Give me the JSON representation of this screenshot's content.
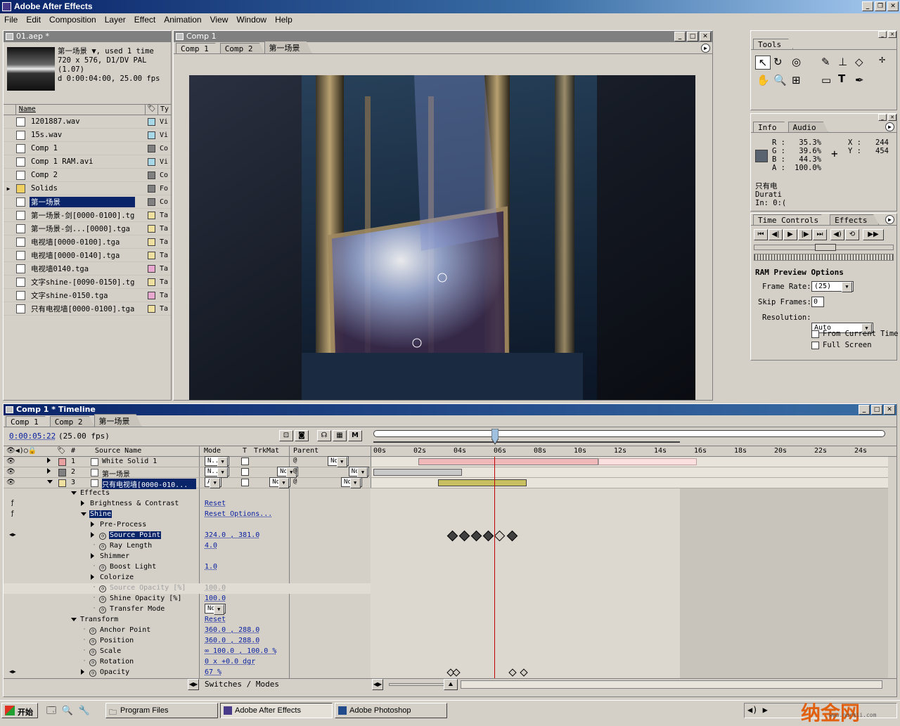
{
  "app": {
    "title": "Adobe After Effects"
  },
  "menu": [
    "File",
    "Edit",
    "Composition",
    "Layer",
    "Effect",
    "Animation",
    "View",
    "Window",
    "Help"
  ],
  "project": {
    "title": "01.aep *",
    "info_line1": "第一场景 ▼, used 1 time",
    "info_line2": "720 x 576, D1/DV PAL (1.07)",
    "info_line3": "d 0:00:04:00, 25.00 fps",
    "col_name": "Name",
    "col_type": "Ty",
    "items": [
      {
        "name": "1201887.wav",
        "type": "Vi",
        "color": "#a8d8e8"
      },
      {
        "name": "15s.wav",
        "type": "Vi",
        "color": "#a8d8e8"
      },
      {
        "name": "Comp 1",
        "type": "Co",
        "color": "#808080"
      },
      {
        "name": "Comp 1 RAM.avi",
        "type": "Vi",
        "color": "#a8d8e8"
      },
      {
        "name": "Comp 2",
        "type": "Co",
        "color": "#808080"
      },
      {
        "name": "Solids",
        "type": "Fo",
        "color": "#808080"
      },
      {
        "name": "第一场景",
        "type": "Co",
        "color": "#808080"
      },
      {
        "name": "第一场景-剑[0000-0100].tga",
        "type": "Ta",
        "color": "#f0e0a0"
      },
      {
        "name": "第一场景-剑...[0000].tga",
        "type": "Ta",
        "color": "#f0e0a0"
      },
      {
        "name": "电视墙[0000-0100].tga",
        "type": "Ta",
        "color": "#f0e0a0"
      },
      {
        "name": "电视墙[0000-0140].tga",
        "type": "Ta",
        "color": "#f0e0a0"
      },
      {
        "name": "电视墙0140.tga",
        "type": "Ta",
        "color": "#e8a8d0"
      },
      {
        "name": "文字shine-[0090-0150].tga",
        "type": "Ta",
        "color": "#f0e0a0"
      },
      {
        "name": "文字shine-0150.tga",
        "type": "Ta",
        "color": "#e8a8d0"
      },
      {
        "name": "只有电视墙[0000-0100].tga",
        "type": "Ta",
        "color": "#f0e0a0"
      }
    ]
  },
  "comp_window": {
    "title": "Comp 1",
    "tabs": [
      "Comp 1",
      "Comp 2",
      "第一场景"
    ]
  },
  "tools": {
    "title": "Tools"
  },
  "info": {
    "tabs": [
      "Info",
      "Audio"
    ],
    "R": "35.3%",
    "G": "39.6%",
    "B": "44.3%",
    "A": "100.0%",
    "X": "244",
    "Y": "454",
    "line1": "只有电",
    "line2": "Durati",
    "line3": "In: 0:("
  },
  "time_controls": {
    "tabs": [
      "Time Controls",
      "Effects"
    ],
    "ram_title": "RAM Preview Options",
    "frame_rate_label": "Frame Rate:",
    "frame_rate": "(25)",
    "skip_label": "Skip Frames:",
    "skip": "0",
    "res_label": "Resolution:",
    "res": "Auto",
    "from_current": "From Current Time",
    "full_screen": "Full Screen"
  },
  "timeline": {
    "title": "Comp 1 * Timeline",
    "tabs": [
      "Comp 1",
      "Comp 2",
      "第一场景"
    ],
    "time": "0:00:05:22",
    "fps": "(25.00 fps)",
    "headers": {
      "num": "#",
      "source": "Source Name",
      "mode": "Mode",
      "t": "T",
      "trkmat": "TrkMat",
      "parent": "Parent"
    },
    "ruler": [
      "00s",
      "02s",
      "04s",
      "06s",
      "08s",
      "10s",
      "12s",
      "14s",
      "16s",
      "18s",
      "20s",
      "22s",
      "24s"
    ],
    "layers": [
      {
        "num": "1",
        "name": "White Solid 1",
        "mode": "N...1",
        "trk": "",
        "parent": "None",
        "color": "#e8a0a0"
      },
      {
        "num": "2",
        "name": "第一场景",
        "mode": "N...1",
        "trk": "None",
        "parent": "None",
        "color": "#808080"
      },
      {
        "num": "3",
        "name": "只有电视墙[0000-010...",
        "mode": "Add",
        "trk": "None",
        "parent": "None",
        "color": "#f0e0a0"
      }
    ],
    "props": [
      {
        "label": "Effects",
        "indent": 1,
        "tri": "dn",
        "value": ""
      },
      {
        "label": "Brightness & Contrast",
        "indent": 2,
        "tri": "r",
        "value": "Reset"
      },
      {
        "label": "Shine",
        "indent": 2,
        "tri": "dn",
        "value": "Reset Options...",
        "sel": true
      },
      {
        "label": "Pre-Process",
        "indent": 3,
        "tri": "r",
        "value": ""
      },
      {
        "label": "Source Point",
        "indent": 3,
        "tri": "r",
        "stop": true,
        "value": "324.0 , 381.0",
        "sel": true
      },
      {
        "label": "Ray Length",
        "indent": 3,
        "stop": true,
        "value": "4.0"
      },
      {
        "label": "Shimmer",
        "indent": 3,
        "tri": "r",
        "value": ""
      },
      {
        "label": "Boost Light",
        "indent": 3,
        "stop": true,
        "value": "1.0"
      },
      {
        "label": "Colorize",
        "indent": 3,
        "tri": "r",
        "value": ""
      },
      {
        "label": "Source Opacity [%]",
        "indent": 3,
        "stop": true,
        "value": "100.0",
        "dim": true
      },
      {
        "label": "Shine Opacity [%]",
        "indent": 3,
        "stop": true,
        "value": "100.0"
      },
      {
        "label": "Transfer Mode",
        "indent": 3,
        "stop": true,
        "value": "None",
        "dd": true
      },
      {
        "label": "Transform",
        "indent": 1,
        "tri": "dn",
        "value": "Reset"
      },
      {
        "label": "Anchor Point",
        "indent": 2,
        "stop": true,
        "value": "360.0 , 288.0"
      },
      {
        "label": "Position",
        "indent": 2,
        "stop": true,
        "value": "360.0 , 288.0"
      },
      {
        "label": "Scale",
        "indent": 2,
        "stop": true,
        "value": "∞ 100.0 , 100.0 %"
      },
      {
        "label": "Rotation",
        "indent": 2,
        "stop": true,
        "value": "0 x +0.0 dgr"
      },
      {
        "label": "Opacity",
        "indent": 2,
        "tri": "r",
        "stop": true,
        "value": "67 %"
      }
    ],
    "switches_label": "Switches / Modes"
  },
  "taskbar": {
    "start": "开始",
    "items": [
      "Program Files",
      "Adobe After Effects",
      "Adobe Photoshop"
    ],
    "watermark": "纳金网",
    "watermark_url": "www.narkii.com"
  }
}
